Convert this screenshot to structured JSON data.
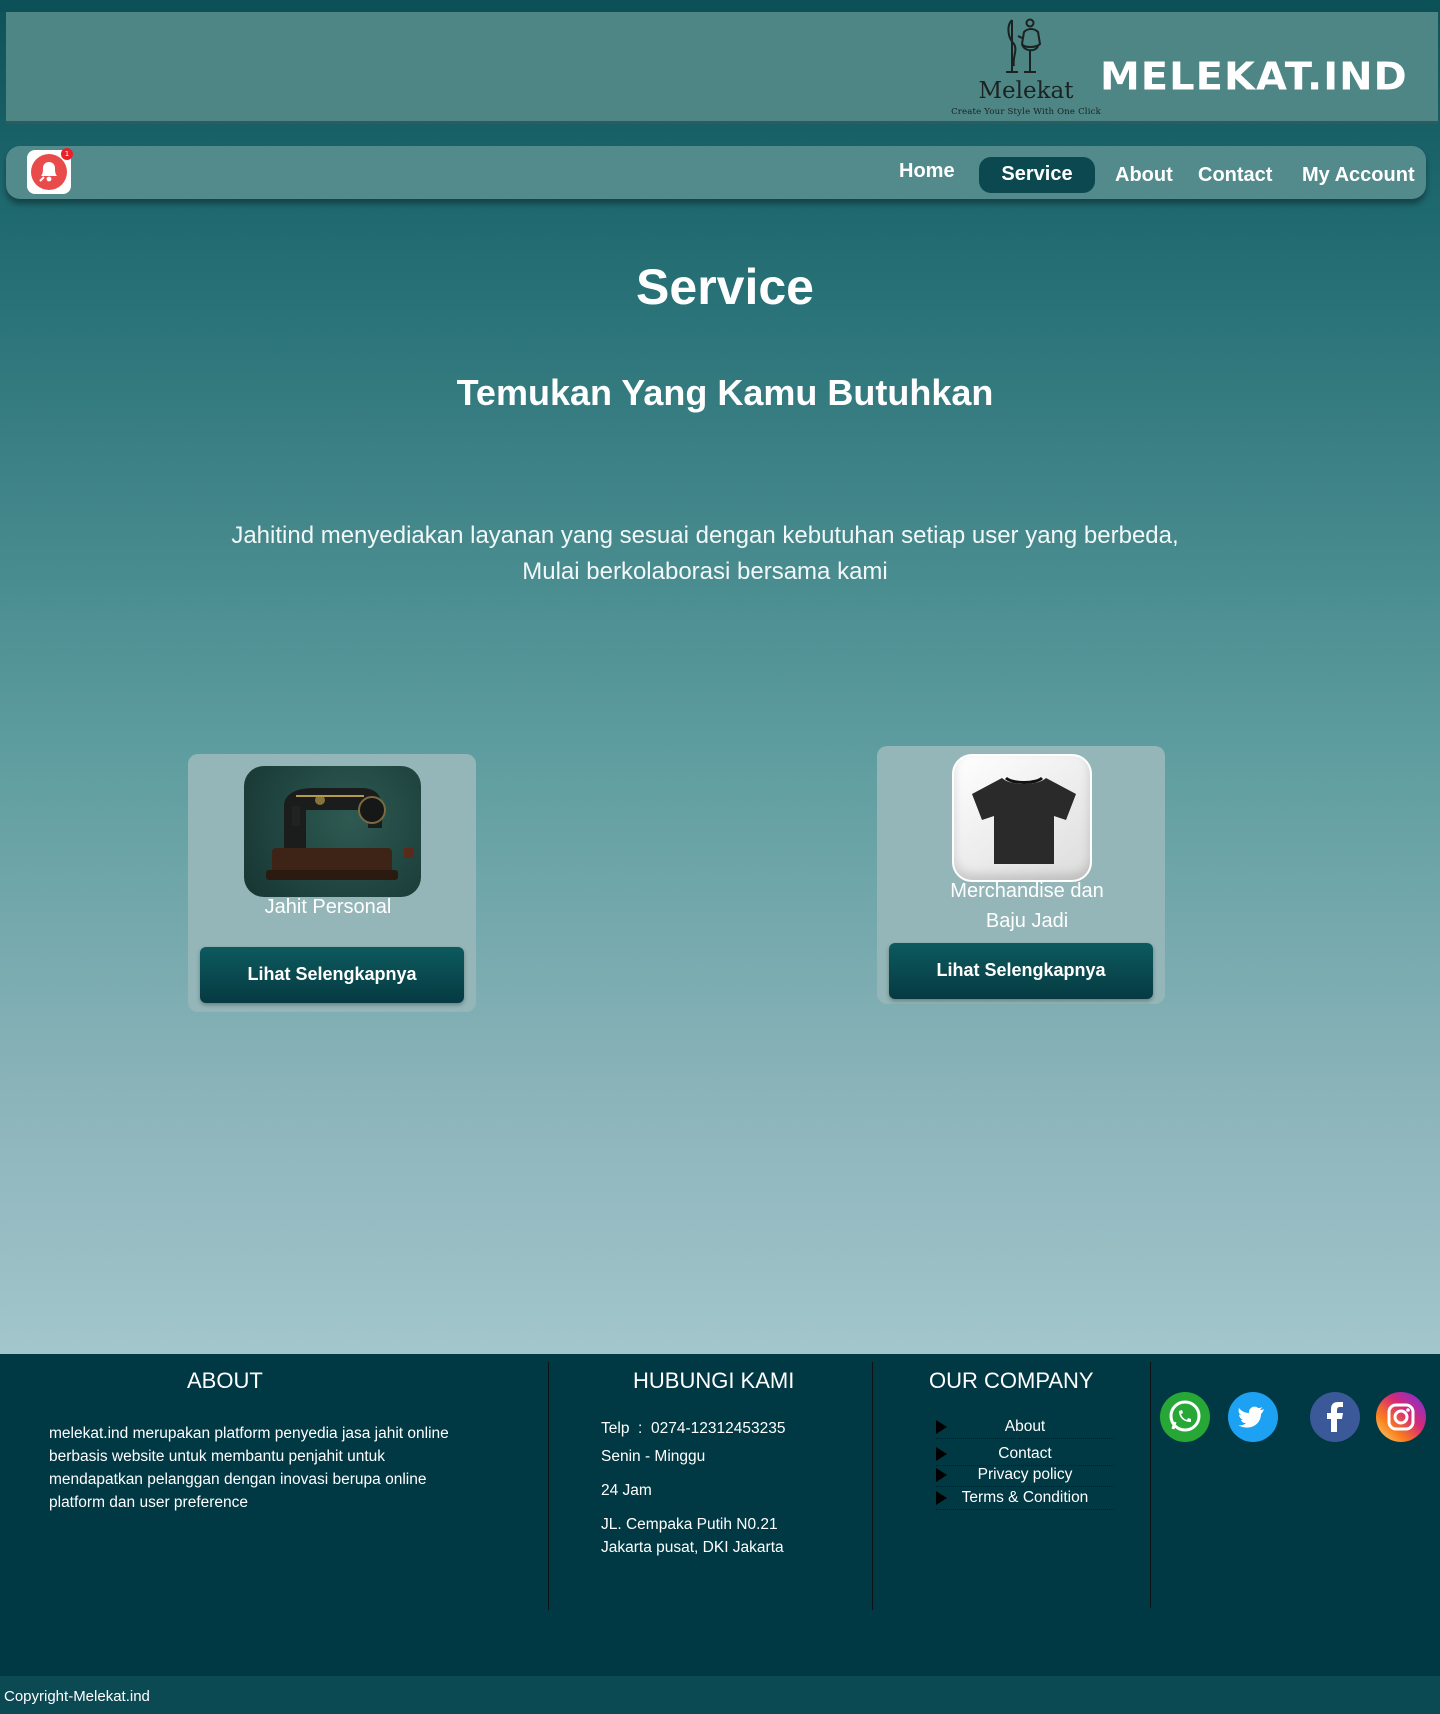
{
  "header": {
    "logo_name": "Melekat",
    "logo_tagline": "Create Your Style With One Click",
    "brand": "MELEKAT.IND"
  },
  "nav": {
    "notification_count": "1",
    "items": [
      "Home",
      "Service",
      "About",
      "Contact",
      "My Account"
    ],
    "active": "Service"
  },
  "main": {
    "title": "Service",
    "subtitle": "Temukan Yang Kamu Butuhkan",
    "intro_line1": "Jahitind menyediakan layanan yang sesuai dengan kebutuhan setiap user yang berbeda,",
    "intro_line2": "Mulai berkolaborasi bersama kami",
    "cards": [
      {
        "label": "Jahit Personal",
        "image": "sewing-machine-icon",
        "button": "Lihat Selengkapnya"
      },
      {
        "label_line1": "Merchandise dan",
        "label_line2": "Baju Jadi",
        "image": "tshirt-icon",
        "button": "Lihat Selengkapnya"
      }
    ]
  },
  "footer": {
    "about": {
      "heading": "ABOUT",
      "lines": [
        "melekat.ind merupakan platform penyedia jasa jahit online",
        "berbasis website untuk membantu penjahit untuk",
        "mendapatkan pelanggan dengan inovasi berupa online",
        "platform dan user preference"
      ]
    },
    "contact": {
      "heading": "HUBUNGI KAMI",
      "phone": "Telp  :  0274-12312453235",
      "days": "Senin - Minggu",
      "hours": "24 Jam",
      "address_line1": "JL. Cempaka Putih N0.21",
      "address_line2": "Jakarta pusat, DKI Jakarta"
    },
    "company": {
      "heading": "OUR COMPANY",
      "links": [
        "About",
        "Contact",
        "Privacy policy",
        "Terms & Condition"
      ]
    },
    "social": [
      "whatsapp-icon",
      "twitter-icon",
      "facebook-icon",
      "instagram-icon"
    ],
    "copyright": "Copyright-Melekat.ind"
  },
  "colors": {
    "header_bg": "#4e8585",
    "nav_bg": "#538b8c",
    "nav_active": "#0b4850",
    "footer_bg": "#003843",
    "button_bg": "#0c5a5e"
  }
}
